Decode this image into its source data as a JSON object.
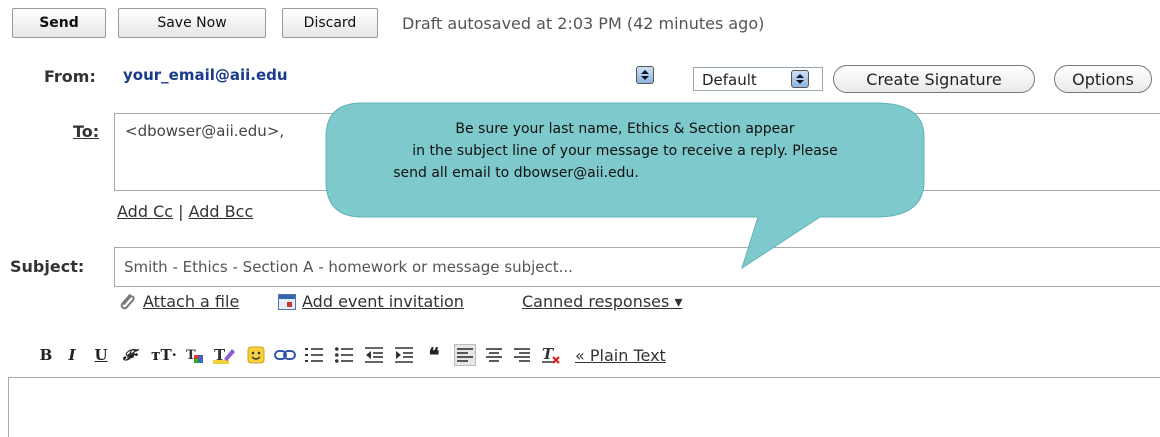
{
  "toolbar": {
    "send": "Send",
    "save_now": "Save Now",
    "discard": "Discard",
    "status": "Draft autosaved at 2:03 PM (42 minutes ago)"
  },
  "from": {
    "label": "From:",
    "value": "your_email@aii.edu",
    "signature_select": "Default",
    "create_signature": "Create Signature",
    "options": "Options"
  },
  "to": {
    "label": "To:",
    "value": "<dbowser@aii.edu>,"
  },
  "add_cc": "Add Cc",
  "separator": "|",
  "add_bcc": "Add Bcc",
  "subject": {
    "label": "Subject:",
    "value": "Smith - Ethics - Section A - homework or message subject..."
  },
  "attachments": {
    "attach_file": "Attach a file",
    "add_event": "Add event invitation",
    "canned_responses": "Canned responses ▾"
  },
  "callout": {
    "line1": "Be sure your last name,  Ethics & Section appear",
    "line2": "in the subject line of your message to receive a reply.  Please",
    "line3": "send all email to dbowser@aii.edu."
  },
  "format_toolbar": {
    "bold": "B",
    "italic": "I",
    "underline": "U",
    "font": "𝓕·",
    "size": "тT·",
    "plain_text": "« Plain Text"
  },
  "colors": {
    "callout_fill": "#7ec9cc",
    "from_value": "#1a3a8a"
  }
}
